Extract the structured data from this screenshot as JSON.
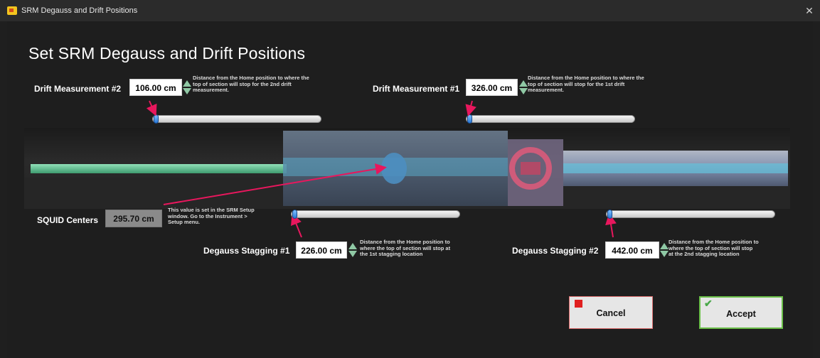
{
  "window": {
    "title": "SRM Degauss and Drift Positions",
    "close_glyph": "✕"
  },
  "page_title": "Set SRM Degauss and Drift Positions",
  "drift2": {
    "label": "Drift Measurement #2",
    "value": "106.00 cm",
    "desc": [
      "Distance from the Home position to  where the",
      "top of section  will stop for the 2nd drift",
      "measurement."
    ],
    "slider_fraction": 0.0
  },
  "drift1": {
    "label": "Drift Measurement #1",
    "value": "326.00 cm",
    "desc": [
      "Distance from the Home position to  where the",
      "top of section  will stop for the 1st drift",
      "measurement."
    ],
    "slider_fraction": 0.0
  },
  "squid": {
    "label": "SQUID Centers",
    "value": "295.70 cm",
    "desc": [
      "This value is set in the SRM Setup",
      "window.  Go to the Instrument >",
      "Setup menu."
    ]
  },
  "degauss1": {
    "label": "Degauss Stagging #1",
    "value": "226.00 cm",
    "desc": [
      "Distance from the Home position to",
      "where the top of section will stop at",
      "the 1st stagging location"
    ],
    "slider_fraction": 0.0
  },
  "degauss2": {
    "label": "Degauss Stagging #2",
    "value": "442.00 cm",
    "desc": [
      "Distance from the Home position to",
      "where the top of section  will stop",
      "at the 2nd stagging location"
    ],
    "slider_fraction": 0.0
  },
  "buttons": {
    "cancel": "Cancel",
    "accept": "Accept"
  },
  "icons": {
    "cancel": "red-square-icon",
    "accept": "check-icon",
    "spinner": "up-down-spinner-icon"
  },
  "colors": {
    "accent_arrow": "#e8175d",
    "slider_knob": "#2a78d6",
    "cancel_border": "#e07070",
    "accept_border": "#6cc04a"
  }
}
